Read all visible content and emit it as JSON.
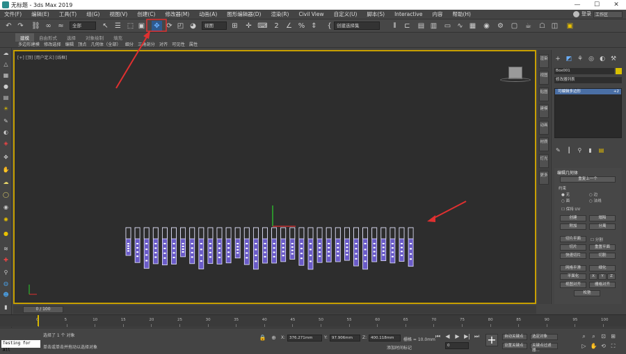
{
  "window": {
    "title": "无标题 - 3ds Max 2019",
    "min": "—",
    "max": "☐",
    "close": "✕"
  },
  "menu": {
    "items": [
      "文件(F)",
      "编辑(E)",
      "工具(T)",
      "组(G)",
      "视图(V)",
      "创建(C)",
      "修改器(M)",
      "动画(A)",
      "图形编辑器(D)",
      "渲染(R)",
      "Civil View",
      "自定义(U)",
      "脚本(S)",
      "Interactive",
      "内容",
      "帮助(H)"
    ],
    "user": "登录",
    "workspace": "工作区"
  },
  "toolbar": {
    "selection_filter": "全部",
    "ref_coord": "视图",
    "named_selection": "创建选择集"
  },
  "ribbon": {
    "tabs": [
      "建模",
      "自由形式",
      "选择",
      "对象绘制",
      "填充"
    ],
    "sub": [
      "多边形建模",
      "修改选择",
      "编辑",
      "顶点",
      "几何体（全部）",
      "细分",
      "三角剖分",
      "对齐",
      "可见性",
      "属性"
    ]
  },
  "viewport": {
    "label": "[+] [顶] [用户定义] [线框]"
  },
  "cmdtabs": [
    "渲染",
    "视图",
    "贴图",
    "建模",
    "动画",
    "材质",
    "灯光",
    "更多"
  ],
  "command_panel": {
    "object_name": "Box001",
    "modifier_list": "修改器列表",
    "stack_item": "可编辑多边形",
    "stack_count": "+2",
    "rollout_title": "编辑几何体",
    "repeat_last": "重复上一个",
    "constraints": "约束",
    "c_none": "无",
    "c_edge": "边",
    "c_face": "面",
    "c_normal": "法线",
    "preserve_uv": "保持 UV",
    "create": "创建",
    "collapse": "塌陷",
    "attach": "附加",
    "detach": "分离",
    "slice_plane": "切片平面",
    "split": "分割",
    "slice": "切片",
    "reset_plane": "重置平面",
    "quickslice": "快速切片",
    "cut": "切割",
    "meshsmooth": "网格平滑",
    "tessellate": "细化",
    "make_planar": "平面化",
    "x": "X",
    "y": "Y",
    "z": "Z",
    "view_align": "视图对齐",
    "grid_align": "栅格对齐",
    "relax": "松弛"
  },
  "timeslider": {
    "label": "0 / 100"
  },
  "trackbar": {
    "ticks": [
      "0",
      "5",
      "10",
      "15",
      "20",
      "25",
      "30",
      "35",
      "40",
      "45",
      "50",
      "55",
      "60",
      "65",
      "70",
      "75",
      "80",
      "85",
      "90",
      "95",
      "100"
    ]
  },
  "status": {
    "maxscript": "Testing for All",
    "selection": "选择了 1 个 对象",
    "prompt": "单击或单击并拖动以选择对象",
    "x_label": "X:",
    "x": "376.271mm",
    "y_label": "Y:",
    "y": "97.906mm",
    "z_label": "Z:",
    "z": "400.118mm",
    "grid": "栅格 = 10.0mm",
    "add_time_tag": "添加时间标记",
    "auto_key": "自动关键点",
    "selected": "选定对象",
    "set_key": "设置关键点",
    "key_filters": "关键点过滤器...",
    "frame": "0"
  },
  "annotation_color": "#e03030",
  "accent": "#d9b800"
}
